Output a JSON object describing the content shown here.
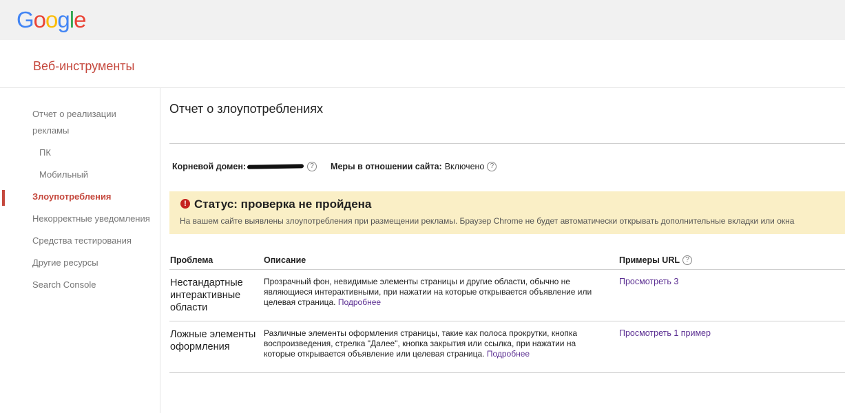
{
  "header": {
    "logo_letters": [
      {
        "ch": "G",
        "color": "#4285F4"
      },
      {
        "ch": "o",
        "color": "#EA4335"
      },
      {
        "ch": "o",
        "color": "#FBBC05"
      },
      {
        "ch": "g",
        "color": "#4285F4"
      },
      {
        "ch": "l",
        "color": "#34A853"
      },
      {
        "ch": "e",
        "color": "#EA4335"
      }
    ],
    "app_title": "Веб-инструменты"
  },
  "sidebar": {
    "items": [
      {
        "label": "Отчет о реализации",
        "active": false
      },
      {
        "label": "рекламы",
        "active": false
      },
      {
        "label": "ПК",
        "active": false
      },
      {
        "label": "Мобильный",
        "active": false
      },
      {
        "label": "Злоупотребления",
        "active": true
      },
      {
        "label": "Некорректные уведомления",
        "active": false
      },
      {
        "label": "Средства тестирования",
        "active": false
      },
      {
        "label": "Другие ресурсы",
        "active": false
      },
      {
        "label": "Search Console",
        "active": false
      }
    ]
  },
  "main": {
    "title": "Отчет о злоупотреблениях",
    "root_domain_label": "Корневой домен:",
    "site_measures_label": "Меры в отношении сайта:",
    "site_measures_value": "Включено",
    "help_glyph": "?",
    "status": {
      "icon_glyph": "!",
      "title": "Статус: проверка не пройдена",
      "text": "На вашем сайте выявлены злоупотребления при размещении рекламы. Браузер Chrome не будет автоматически открывать дополнительные вкладки или окна"
    },
    "table": {
      "headers": {
        "problem": "Проблема",
        "description": "Описание",
        "urls": "Примеры URL"
      },
      "rows": [
        {
          "problem": "Нестандартные интерактивные области",
          "description": "Прозрачный фон, невидимые элементы страницы и другие области, обычно не являющиеся интерактивными, при нажатии на которые открывается объявление или целевая страница.",
          "more": "Подробнее",
          "url_link": "Просмотреть 3"
        },
        {
          "problem": "Ложные элементы оформления",
          "description": "Различные элементы оформления страницы, такие как полоса прокрутки, кнопка воспроизведения, стрелка \"Далее\", кнопка закрытия или ссылка, при нажатии на которые открывается объявление или целевая страница.",
          "more": "Подробнее",
          "url_link": "Просмотреть 1 пример"
        }
      ]
    }
  }
}
